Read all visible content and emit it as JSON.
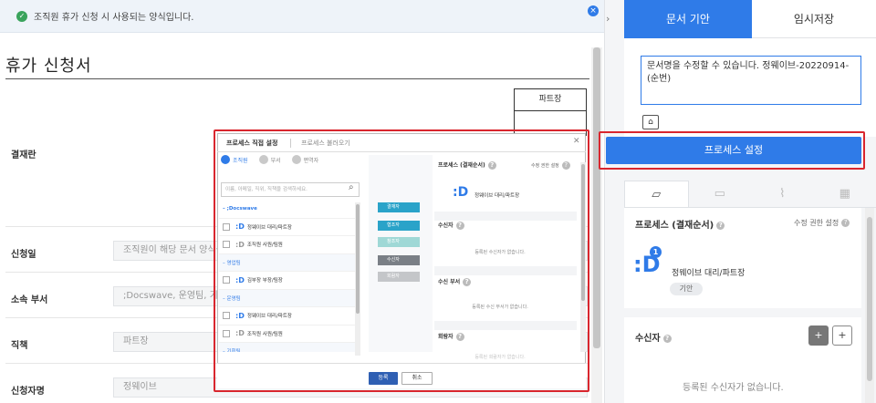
{
  "notice": {
    "text": "조직원 휴가 신청 시 사용되는 양식입니다.",
    "close": "×"
  },
  "document": {
    "title": "휴가 신청서",
    "approval_column": "파트장",
    "rows": [
      {
        "label": "결재란",
        "value": ""
      },
      {
        "label": "신청일",
        "value": "조직원이 해당 문서 양식을"
      },
      {
        "label": "소속 부서",
        "value": ";Docswave, 운영팀, 기획"
      },
      {
        "label": "직책",
        "value": "파트장"
      },
      {
        "label": "신청자명",
        "value": "정웨이브"
      }
    ]
  },
  "right_panel": {
    "collapse": "›",
    "tabs": {
      "draft": "문서 기안",
      "temp": "임시저장"
    },
    "memo": "문서명을 수정할 수 있습니다. 정웨이브-20220914-(순번)",
    "process_button": "프로세스 설정",
    "process": {
      "title": "프로세스 (결재순서)",
      "perm": "수정 권한 설정",
      "approver": "정웨이브 대리/파트장",
      "chip": "기안"
    },
    "receiver": {
      "title": "수신자",
      "empty": "등록된 수신자가 없습니다."
    }
  },
  "modal": {
    "tab_direct": "프로세스 직접 설정",
    "tab_load": "프로세스 불러오기",
    "filters": [
      "조직원",
      "부서",
      "편역자"
    ],
    "search_placeholder": "이름, 아메일, 직위, 직책을 검색하세요.",
    "list": [
      {
        "type": "root",
        "label": "– ;Docswave"
      },
      {
        "type": "item",
        "label": "정웨이브 대리/파트장"
      },
      {
        "type": "item",
        "label": "조직원 사원/팀원"
      },
      {
        "type": "grp",
        "label": "– 영업팀"
      },
      {
        "type": "item",
        "label": "김부장 부장/팀장"
      },
      {
        "type": "grp",
        "label": "– 운영팀"
      },
      {
        "type": "item",
        "label": "정웨이브 대리/파트장"
      },
      {
        "type": "item",
        "label": "조직원 사원/팀원"
      },
      {
        "type": "grp",
        "label": "– 기획팀"
      }
    ],
    "buttons": [
      "결재자",
      "협조자",
      "참조자",
      "수신자",
      "회람자"
    ],
    "button_colors": [
      "#2aa3c9",
      "#2aa3c9",
      "#9fd8d6",
      "#7a7f86",
      "#c4c6c9"
    ],
    "right_sections": {
      "process": "프로세스 (결재순서)",
      "perm": "수정 권한 설정",
      "approver": "정웨이브 대리/파트장",
      "receiver": "수신자",
      "receiver_empty": "등록된 수신자가 없습니다.",
      "recv_dept": "수신 부서",
      "recv_dept_empty": "등록된 수신 부서가 없습니다.",
      "circulate": "회람자",
      "circulate_empty": "등록된 회람자가 없습니다."
    },
    "ok": "등록",
    "cancel": "취소"
  }
}
